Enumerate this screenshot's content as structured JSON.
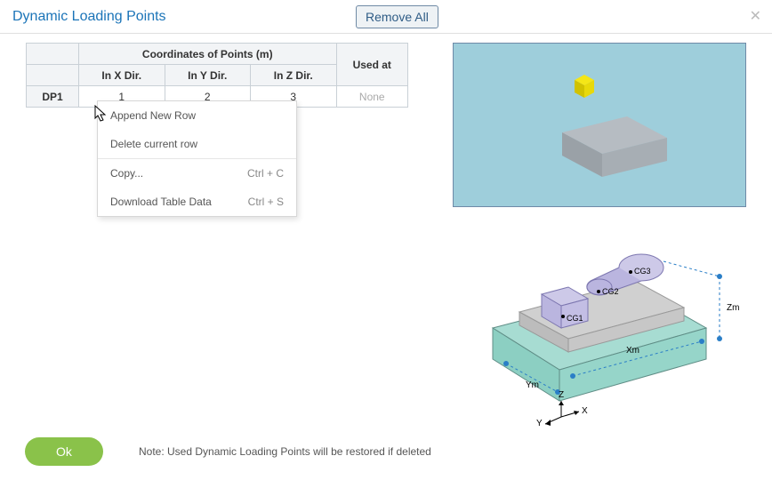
{
  "title": "Dynamic Loading Points",
  "buttons": {
    "remove_all": "Remove All",
    "ok": "Ok",
    "close": "✕"
  },
  "table": {
    "group_header": "Coordinates of Points (m)",
    "headers": {
      "x": "In X Dir.",
      "y": "In Y Dir.",
      "z": "In Z Dir.",
      "used": "Used at"
    },
    "row": {
      "label": "DP1",
      "x": "1",
      "y": "2",
      "z": "3",
      "used": "None"
    }
  },
  "context_menu": {
    "append": "Append New Row",
    "delete": "Delete current row",
    "copy": "Copy...",
    "copy_shortcut": "Ctrl + C",
    "download": "Download Table Data",
    "download_shortcut": "Ctrl + S"
  },
  "diagram": {
    "cg1": "CG1",
    "cg2": "CG2",
    "cg3": "CG3",
    "xm": "Xm",
    "ym": "Ym",
    "zm": "Zm",
    "axis_x": "X",
    "axis_y": "Y",
    "axis_z": "Z"
  },
  "footer_note": "Note: Used Dynamic Loading Points will be restored if deleted"
}
